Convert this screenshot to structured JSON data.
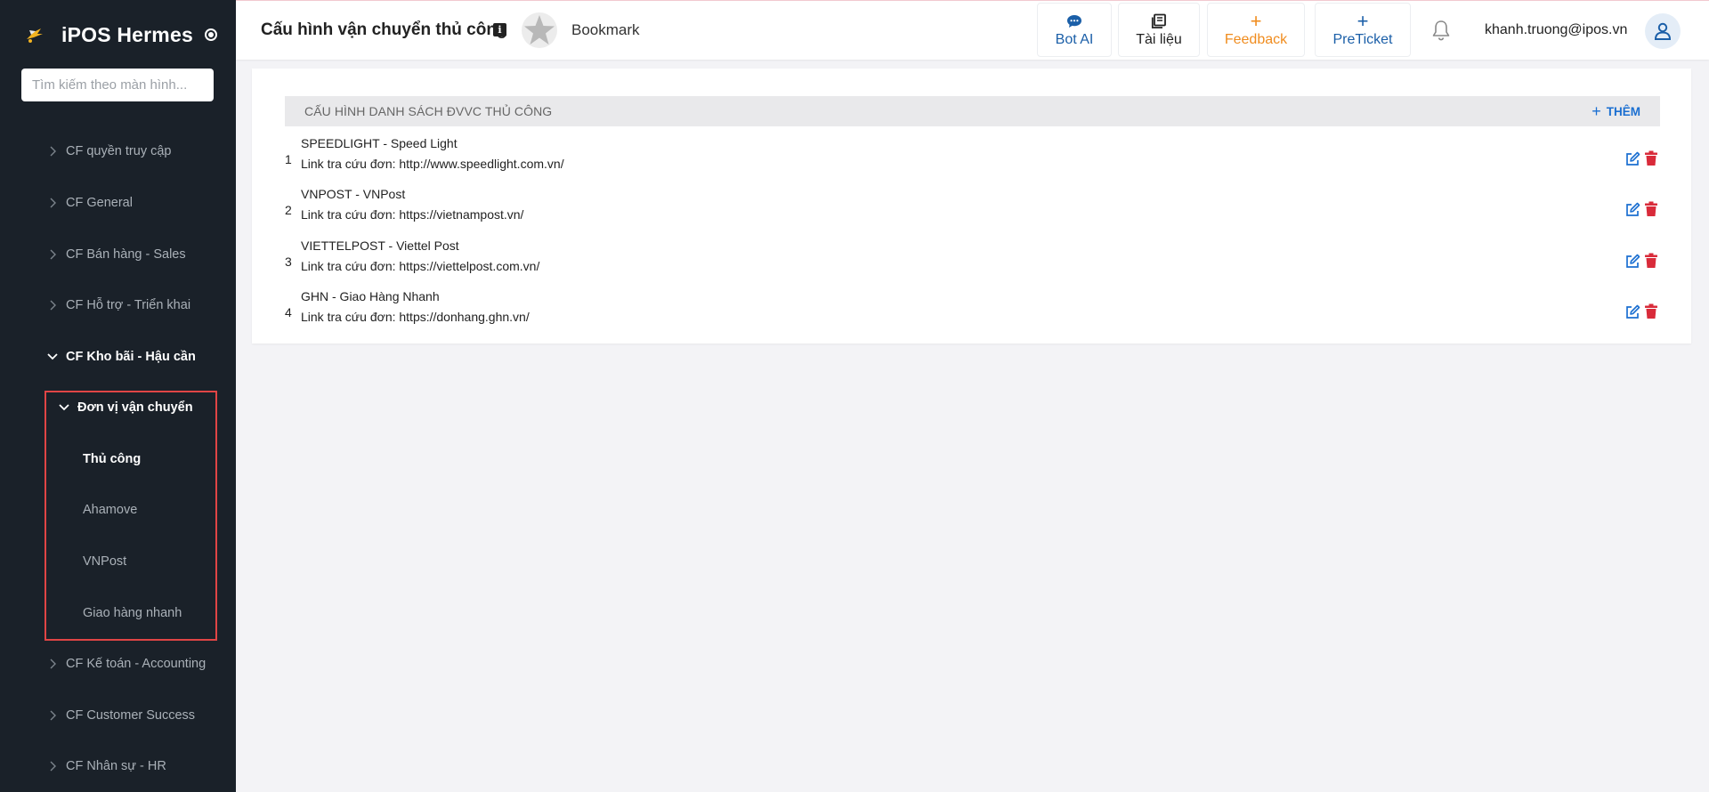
{
  "app": {
    "name": "iPOS Hermes",
    "search_placeholder": "Tìm kiếm theo màn hình..."
  },
  "sidebar": {
    "items": [
      {
        "label": "CF quyền truy cập",
        "state": "collapsed"
      },
      {
        "label": "CF General",
        "state": "collapsed"
      },
      {
        "label": "CF Bán hàng - Sales",
        "state": "collapsed"
      },
      {
        "label": "CF Hỗ trợ - Triển khai",
        "state": "collapsed"
      },
      {
        "label": "CF Kho bãi - Hậu cần",
        "state": "expanded"
      },
      {
        "label": "CF Kế toán - Accounting",
        "state": "collapsed"
      },
      {
        "label": "CF Customer Success",
        "state": "collapsed"
      },
      {
        "label": "CF Nhân sự - HR",
        "state": "collapsed"
      }
    ],
    "submenu": {
      "group_label": "Đơn vị vận chuyển",
      "leaves": [
        "Thủ công",
        "Ahamove",
        "VNPost",
        "Giao hàng nhanh"
      ],
      "active_leaf": "Thủ công"
    }
  },
  "header": {
    "page_title": "Cấu hình vận chuyển thủ công",
    "bookmark_label": "Bookmark",
    "buttons": {
      "bot_ai": "Bot AI",
      "docs": "Tài liệu",
      "feedback": "Feedback",
      "preticket": "PreTicket"
    },
    "user_email": "khanh.truong@ipos.vn"
  },
  "main": {
    "section_title": "CẤU HÌNH DANH SÁCH ĐVVC THỦ CÔNG",
    "add_label": "THÊM",
    "link_prefix": "Link tra cứu đơn: ",
    "rows": [
      {
        "index": "1",
        "name": "SPEEDLIGHT - Speed Light",
        "link": "Link tra cứu đơn: http://www.speedlight.com.vn/"
      },
      {
        "index": "2",
        "name": "VNPOST - VNPost",
        "link": "Link tra cứu đơn: https://vietnampost.vn/"
      },
      {
        "index": "3",
        "name": "VIETTELPOST - Viettel Post",
        "link": "Link tra cứu đơn: https://viettelpost.com.vn/"
      },
      {
        "index": "4",
        "name": "GHN - Giao Hàng Nhanh",
        "link": "Link tra cứu đơn: https://donhang.ghn.vn/"
      }
    ]
  },
  "colors": {
    "sidebar_bg": "#1a2129",
    "accent_blue": "#1b6fd1",
    "feedback_orange": "#f08c1e",
    "delete_red": "#d92b3a",
    "highlight_red": "#e04545"
  }
}
